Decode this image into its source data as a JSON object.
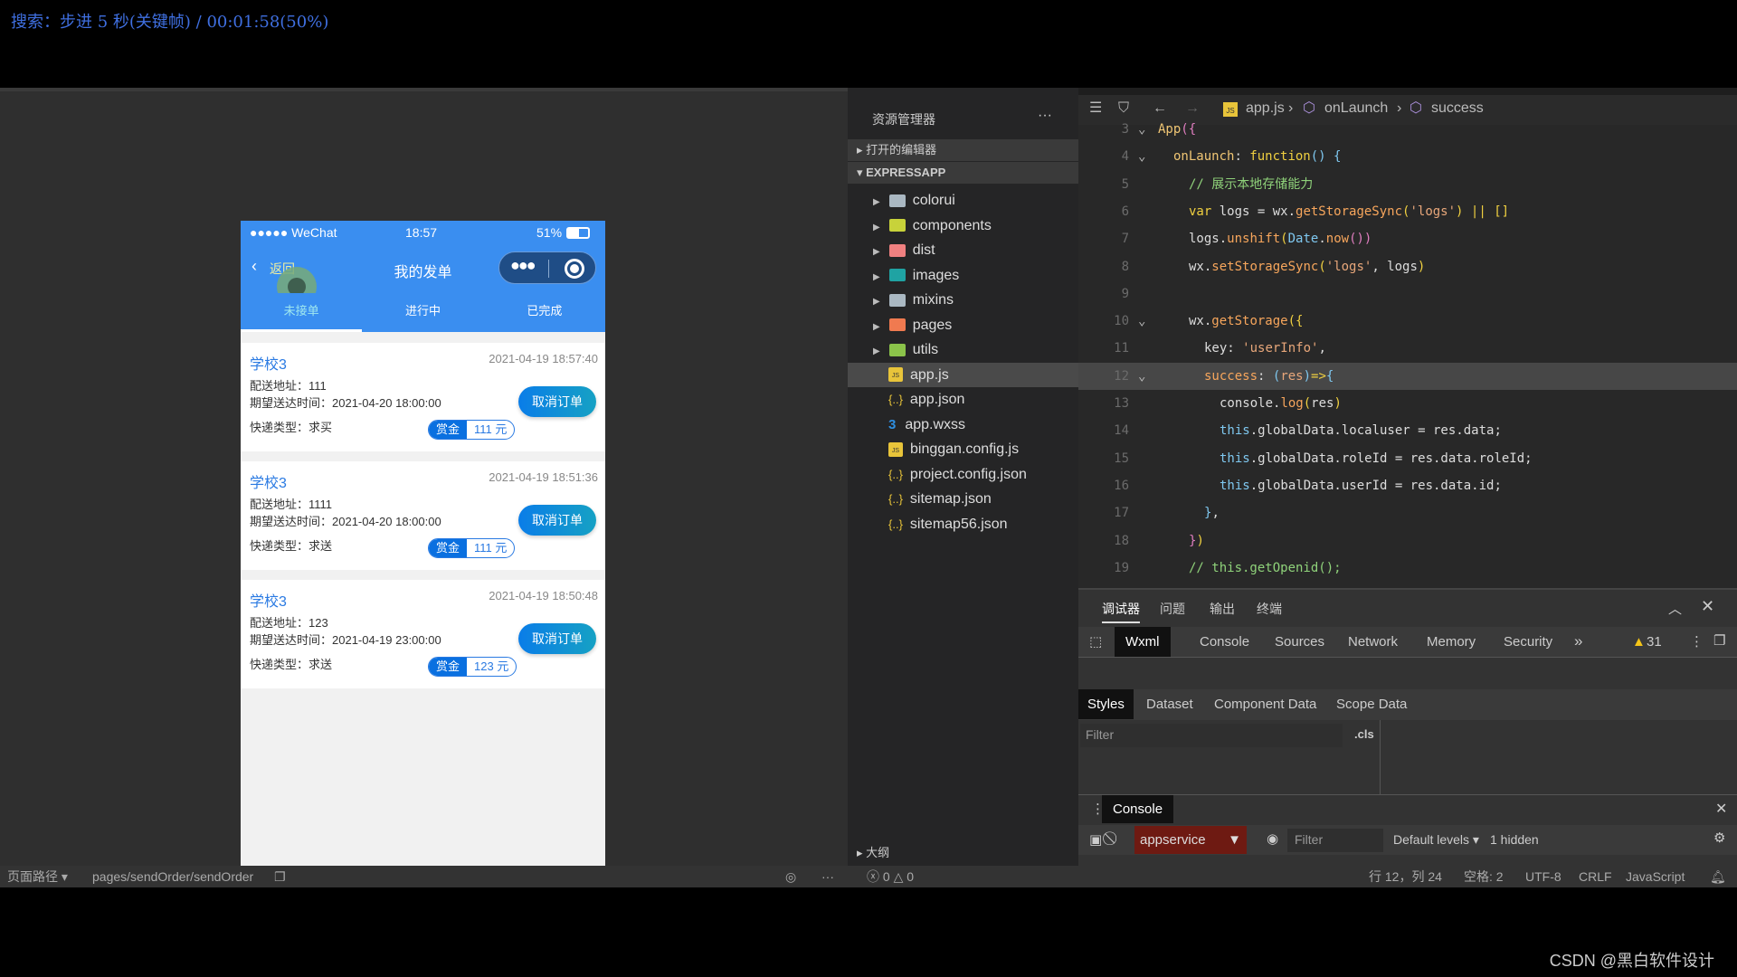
{
  "overlay_title": "搜索：步进 5 秒(关键帧) / 00:01:58(50%)",
  "watermark": "CSDN @黑白软件设计",
  "phone": {
    "carrier": "●●●●● WeChat",
    "time": "18:57",
    "battery": "51%",
    "back_label": "返回",
    "title": "我的发单",
    "tabs": [
      "未接单",
      "进行中",
      "已完成"
    ],
    "orders": [
      {
        "school": "学校3",
        "created": "2021-04-19 18:57:40",
        "address": "配送地址：111",
        "expected": "期望送达时间：2021-04-20 18:00:00",
        "type": "快递类型：求买",
        "reward_label": "赏金",
        "reward": "111 元",
        "cancel": "取消订单"
      },
      {
        "school": "学校3",
        "created": "2021-04-19 18:51:36",
        "address": "配送地址：1111",
        "expected": "期望送达时间：2021-04-20 18:00:00",
        "type": "快递类型：求送",
        "reward_label": "赏金",
        "reward": "111 元",
        "cancel": "取消订单"
      },
      {
        "school": "学校3",
        "created": "2021-04-19 18:50:48",
        "address": "配送地址：123",
        "expected": "期望送达时间：2021-04-19 23:00:00",
        "type": "快递类型：求送",
        "reward_label": "赏金",
        "reward": "123 元",
        "cancel": "取消订单"
      }
    ]
  },
  "explorer": {
    "title": "资源管理器",
    "open_editors": "打开的编辑器",
    "project": "EXPRESSAPP",
    "outline": "大纲",
    "items": [
      {
        "name": "colorui",
        "kind": "folder",
        "color": "#aab8c2"
      },
      {
        "name": "components",
        "kind": "folder",
        "color": "#c8d23a"
      },
      {
        "name": "dist",
        "kind": "folder",
        "color": "#f08080"
      },
      {
        "name": "images",
        "kind": "folder",
        "color": "#1fa3a3"
      },
      {
        "name": "mixins",
        "kind": "folder",
        "color": "#aab8c2"
      },
      {
        "name": "pages",
        "kind": "folder",
        "color": "#f07a50"
      },
      {
        "name": "utils",
        "kind": "folder",
        "color": "#8bc34a"
      },
      {
        "name": "app.js",
        "kind": "js",
        "selected": true
      },
      {
        "name": "app.json",
        "kind": "json"
      },
      {
        "name": "app.wxss",
        "kind": "css"
      },
      {
        "name": "binggan.config.js",
        "kind": "js"
      },
      {
        "name": "project.config.json",
        "kind": "json"
      },
      {
        "name": "sitemap.json",
        "kind": "json"
      },
      {
        "name": "sitemap56.json",
        "kind": "json"
      }
    ]
  },
  "editor": {
    "breadcrumb": [
      "app.js",
      "onLaunch",
      "success"
    ],
    "lines": [
      {
        "n": "3",
        "fold": true,
        "indent": 0,
        "tokens": [
          [
            "App",
            "k1"
          ],
          [
            "({",
            "k7"
          ]
        ]
      },
      {
        "n": "4",
        "fold": true,
        "indent": 1,
        "tokens": [
          [
            "onLaunch",
            "k1"
          ],
          [
            ": ",
            "k2"
          ],
          [
            "function",
            "k8"
          ],
          [
            "() {",
            "k6"
          ]
        ]
      },
      {
        "n": "5",
        "indent": 2,
        "tokens": [
          [
            "// 展示本地存储能力",
            "k5"
          ]
        ]
      },
      {
        "n": "6",
        "indent": 2,
        "tokens": [
          [
            "var",
            "k8"
          ],
          [
            " logs = wx.",
            "k2"
          ],
          [
            "getStorageSync",
            "k3"
          ],
          [
            "(",
            "k8"
          ],
          [
            "'logs'",
            "k4"
          ],
          [
            ") || []",
            "k8"
          ]
        ]
      },
      {
        "n": "7",
        "indent": 2,
        "tokens": [
          [
            "logs.",
            "k2"
          ],
          [
            "unshift",
            "k3"
          ],
          [
            "(",
            "k8"
          ],
          [
            "Date",
            "k6"
          ],
          [
            ".",
            "k2"
          ],
          [
            "now",
            "k3"
          ],
          [
            "())",
            "k7"
          ]
        ]
      },
      {
        "n": "8",
        "indent": 2,
        "tokens": [
          [
            "wx.",
            "k2"
          ],
          [
            "setStorageSync",
            "k3"
          ],
          [
            "(",
            "k8"
          ],
          [
            "'logs'",
            "k4"
          ],
          [
            ", logs",
            "k2"
          ],
          [
            ")",
            "k8"
          ]
        ]
      },
      {
        "n": "9",
        "indent": 0,
        "tokens": []
      },
      {
        "n": "10",
        "fold": true,
        "indent": 2,
        "tokens": [
          [
            "wx.",
            "k2"
          ],
          [
            "getStorage",
            "k3"
          ],
          [
            "({",
            "k8"
          ]
        ]
      },
      {
        "n": "11",
        "indent": 3,
        "tokens": [
          [
            "key",
            "k2"
          ],
          [
            ": ",
            "k2"
          ],
          [
            "'userInfo'",
            "k4"
          ],
          [
            ",",
            "k2"
          ]
        ]
      },
      {
        "n": "12",
        "fold": true,
        "indent": 3,
        "hl": true,
        "tokens": [
          [
            "success",
            "k3"
          ],
          [
            ": ",
            "k2"
          ],
          [
            "(",
            "k6"
          ],
          [
            "res",
            "k4"
          ],
          [
            ")",
            "k6"
          ],
          [
            "=>",
            "k8"
          ],
          [
            "{",
            "k6"
          ]
        ]
      },
      {
        "n": "13",
        "indent": 4,
        "tokens": [
          [
            "console.",
            "k2"
          ],
          [
            "log",
            "k3"
          ],
          [
            "(",
            "k8"
          ],
          [
            "res",
            "k2"
          ],
          [
            ")",
            "k8"
          ]
        ]
      },
      {
        "n": "14",
        "indent": 4,
        "tokens": [
          [
            "this",
            "k6"
          ],
          [
            ".globalData.localuser = res.data;",
            "k2"
          ]
        ]
      },
      {
        "n": "15",
        "indent": 4,
        "tokens": [
          [
            "this",
            "k6"
          ],
          [
            ".globalData.roleId = res.data.roleId;",
            "k2"
          ]
        ]
      },
      {
        "n": "16",
        "indent": 4,
        "tokens": [
          [
            "this",
            "k6"
          ],
          [
            ".globalData.userId = res.data.id;",
            "k2"
          ]
        ]
      },
      {
        "n": "17",
        "indent": 3,
        "tokens": [
          [
            "}",
            "k6"
          ],
          [
            ",",
            "k2"
          ]
        ]
      },
      {
        "n": "18",
        "indent": 2,
        "tokens": [
          [
            "}",
            "k7"
          ],
          [
            ")",
            "k8"
          ]
        ]
      },
      {
        "n": "19",
        "indent": 2,
        "tokens": [
          [
            "// this.getOpenid();",
            "k5"
          ]
        ]
      }
    ]
  },
  "devtools": {
    "top_tabs": [
      "调试器",
      "问题",
      "输出",
      "终端"
    ],
    "panel_tabs": [
      "Wxml",
      "Console",
      "Sources",
      "Network",
      "Memory",
      "Security"
    ],
    "more": "»",
    "warnings": "31",
    "sub_tabs": [
      "Styles",
      "Dataset",
      "Component Data",
      "Scope Data"
    ],
    "filter_placeholder": "Filter",
    "cls": ".cls",
    "drawer_tab": "Console",
    "context": "appservice",
    "console_filter": "Filter",
    "levels": "Default levels",
    "hidden": "1 hidden"
  },
  "statusbar": {
    "path_label": "页面路径",
    "path": "pages/sendOrder/sendOrder",
    "errors": "0",
    "warns": "0",
    "cursor": "行 12，列 24",
    "spaces": "空格: 2",
    "encoding": "UTF-8",
    "eol": "CRLF",
    "language": "JavaScript"
  }
}
